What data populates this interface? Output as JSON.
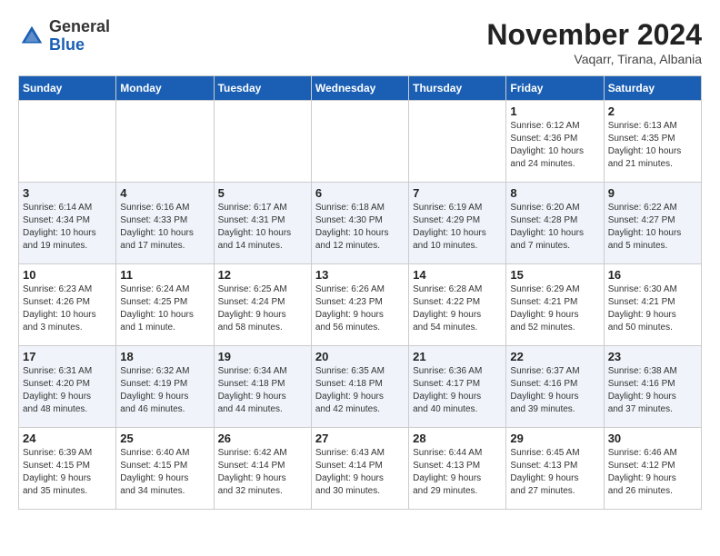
{
  "header": {
    "logo_general": "General",
    "logo_blue": "Blue",
    "month_title": "November 2024",
    "location": "Vaqarr, Tirana, Albania"
  },
  "days_of_week": [
    "Sunday",
    "Monday",
    "Tuesday",
    "Wednesday",
    "Thursday",
    "Friday",
    "Saturday"
  ],
  "weeks": [
    [
      {
        "day": "",
        "info": ""
      },
      {
        "day": "",
        "info": ""
      },
      {
        "day": "",
        "info": ""
      },
      {
        "day": "",
        "info": ""
      },
      {
        "day": "",
        "info": ""
      },
      {
        "day": "1",
        "info": "Sunrise: 6:12 AM\nSunset: 4:36 PM\nDaylight: 10 hours\nand 24 minutes."
      },
      {
        "day": "2",
        "info": "Sunrise: 6:13 AM\nSunset: 4:35 PM\nDaylight: 10 hours\nand 21 minutes."
      }
    ],
    [
      {
        "day": "3",
        "info": "Sunrise: 6:14 AM\nSunset: 4:34 PM\nDaylight: 10 hours\nand 19 minutes."
      },
      {
        "day": "4",
        "info": "Sunrise: 6:16 AM\nSunset: 4:33 PM\nDaylight: 10 hours\nand 17 minutes."
      },
      {
        "day": "5",
        "info": "Sunrise: 6:17 AM\nSunset: 4:31 PM\nDaylight: 10 hours\nand 14 minutes."
      },
      {
        "day": "6",
        "info": "Sunrise: 6:18 AM\nSunset: 4:30 PM\nDaylight: 10 hours\nand 12 minutes."
      },
      {
        "day": "7",
        "info": "Sunrise: 6:19 AM\nSunset: 4:29 PM\nDaylight: 10 hours\nand 10 minutes."
      },
      {
        "day": "8",
        "info": "Sunrise: 6:20 AM\nSunset: 4:28 PM\nDaylight: 10 hours\nand 7 minutes."
      },
      {
        "day": "9",
        "info": "Sunrise: 6:22 AM\nSunset: 4:27 PM\nDaylight: 10 hours\nand 5 minutes."
      }
    ],
    [
      {
        "day": "10",
        "info": "Sunrise: 6:23 AM\nSunset: 4:26 PM\nDaylight: 10 hours\nand 3 minutes."
      },
      {
        "day": "11",
        "info": "Sunrise: 6:24 AM\nSunset: 4:25 PM\nDaylight: 10 hours\nand 1 minute."
      },
      {
        "day": "12",
        "info": "Sunrise: 6:25 AM\nSunset: 4:24 PM\nDaylight: 9 hours\nand 58 minutes."
      },
      {
        "day": "13",
        "info": "Sunrise: 6:26 AM\nSunset: 4:23 PM\nDaylight: 9 hours\nand 56 minutes."
      },
      {
        "day": "14",
        "info": "Sunrise: 6:28 AM\nSunset: 4:22 PM\nDaylight: 9 hours\nand 54 minutes."
      },
      {
        "day": "15",
        "info": "Sunrise: 6:29 AM\nSunset: 4:21 PM\nDaylight: 9 hours\nand 52 minutes."
      },
      {
        "day": "16",
        "info": "Sunrise: 6:30 AM\nSunset: 4:21 PM\nDaylight: 9 hours\nand 50 minutes."
      }
    ],
    [
      {
        "day": "17",
        "info": "Sunrise: 6:31 AM\nSunset: 4:20 PM\nDaylight: 9 hours\nand 48 minutes."
      },
      {
        "day": "18",
        "info": "Sunrise: 6:32 AM\nSunset: 4:19 PM\nDaylight: 9 hours\nand 46 minutes."
      },
      {
        "day": "19",
        "info": "Sunrise: 6:34 AM\nSunset: 4:18 PM\nDaylight: 9 hours\nand 44 minutes."
      },
      {
        "day": "20",
        "info": "Sunrise: 6:35 AM\nSunset: 4:18 PM\nDaylight: 9 hours\nand 42 minutes."
      },
      {
        "day": "21",
        "info": "Sunrise: 6:36 AM\nSunset: 4:17 PM\nDaylight: 9 hours\nand 40 minutes."
      },
      {
        "day": "22",
        "info": "Sunrise: 6:37 AM\nSunset: 4:16 PM\nDaylight: 9 hours\nand 39 minutes."
      },
      {
        "day": "23",
        "info": "Sunrise: 6:38 AM\nSunset: 4:16 PM\nDaylight: 9 hours\nand 37 minutes."
      }
    ],
    [
      {
        "day": "24",
        "info": "Sunrise: 6:39 AM\nSunset: 4:15 PM\nDaylight: 9 hours\nand 35 minutes."
      },
      {
        "day": "25",
        "info": "Sunrise: 6:40 AM\nSunset: 4:15 PM\nDaylight: 9 hours\nand 34 minutes."
      },
      {
        "day": "26",
        "info": "Sunrise: 6:42 AM\nSunset: 4:14 PM\nDaylight: 9 hours\nand 32 minutes."
      },
      {
        "day": "27",
        "info": "Sunrise: 6:43 AM\nSunset: 4:14 PM\nDaylight: 9 hours\nand 30 minutes."
      },
      {
        "day": "28",
        "info": "Sunrise: 6:44 AM\nSunset: 4:13 PM\nDaylight: 9 hours\nand 29 minutes."
      },
      {
        "day": "29",
        "info": "Sunrise: 6:45 AM\nSunset: 4:13 PM\nDaylight: 9 hours\nand 27 minutes."
      },
      {
        "day": "30",
        "info": "Sunrise: 6:46 AM\nSunset: 4:12 PM\nDaylight: 9 hours\nand 26 minutes."
      }
    ]
  ]
}
